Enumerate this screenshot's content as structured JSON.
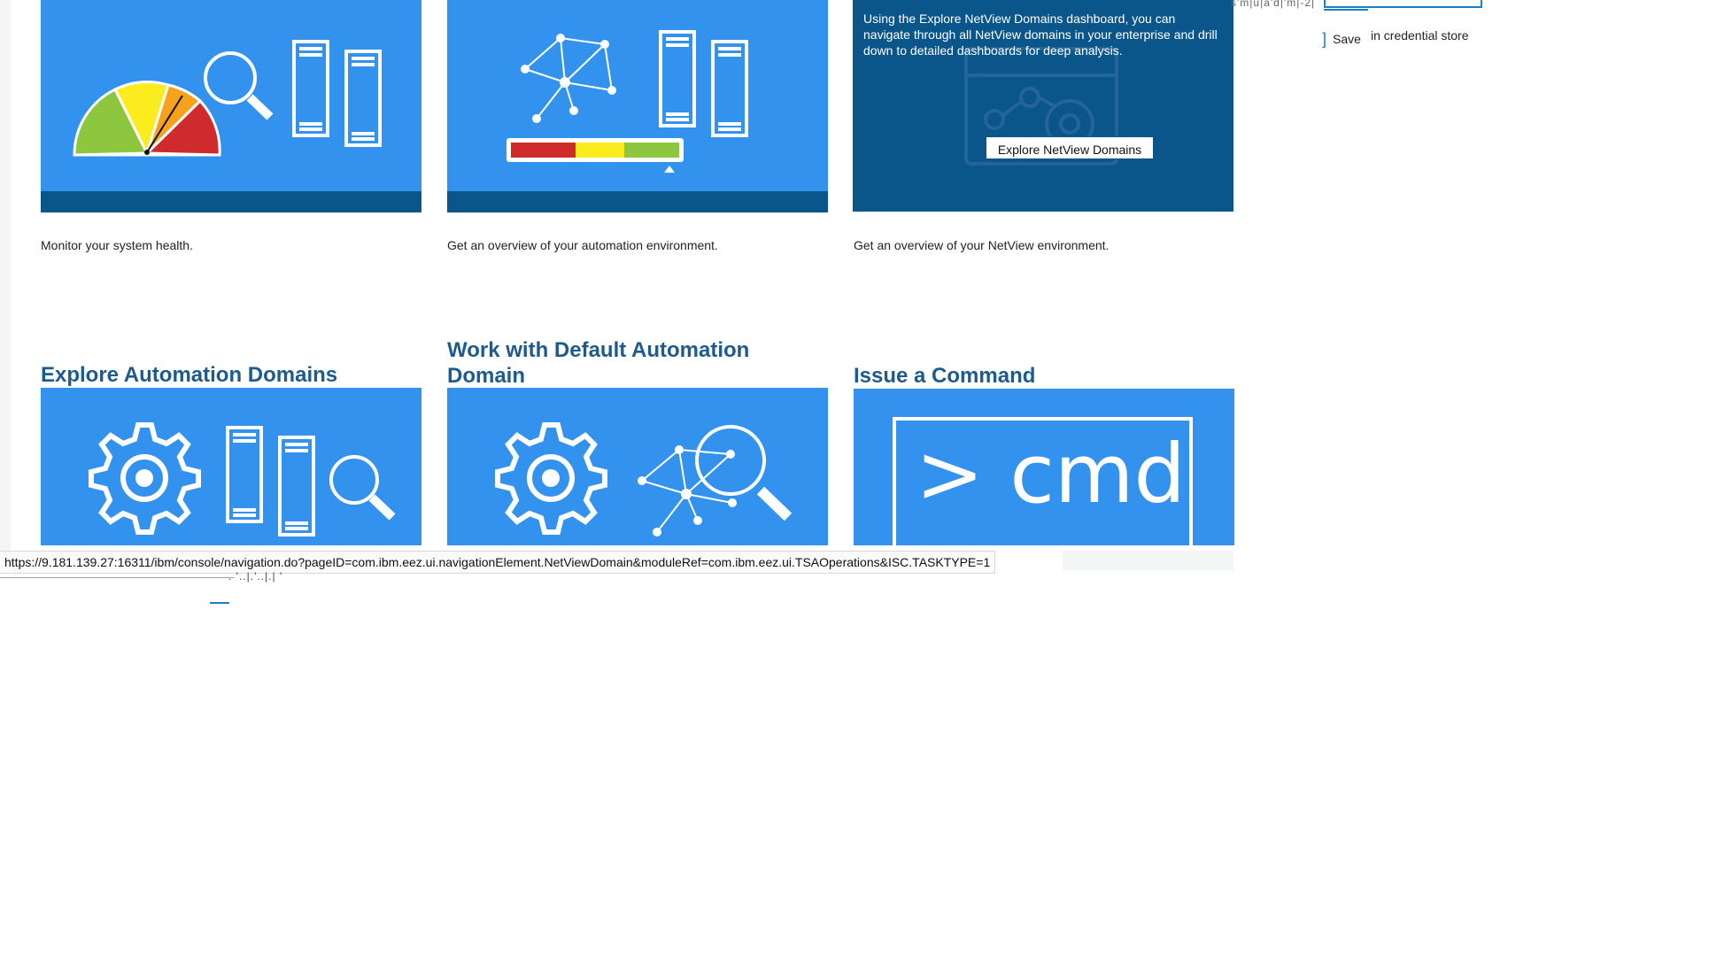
{
  "tiles_top": [
    {
      "description": "Monitor your system health."
    },
    {
      "description": "Get an overview of your automation environment."
    },
    {
      "description": "Get an overview of your NetView environment."
    }
  ],
  "netview_overlay": {
    "text": "Using the Explore NetView Domains dashboard, you can navigate through all NetView domains in your enterprise and drill down to detailed dashboards for deep analysis.",
    "button_label": "Explore NetView Domains"
  },
  "tiles_bottom": [
    {
      "title": "Explore Automation Domains"
    },
    {
      "title": "Work with Default Automation Domain"
    },
    {
      "title": "Issue a Command",
      "cmd_text": "> cmd"
    }
  ],
  "credentials": {
    "scribble": "s'm|u|a'd|'m|-2|",
    "save_label": "Save",
    "store_text": "in credential store"
  },
  "status_bar": {
    "url": "https://9.181.139.27:16311/ibm/console/navigation.do?pageID=com.ibm.eez.ui.navigationElement.NetViewDomain&moduleRef=com.ibm.eez.ui.TSAOperations&ISC.TASKTYPE=1"
  },
  "scribble_bottom": ". '..|.'..|.|  '",
  "colors": {
    "tile_blue": "#3392ee",
    "tile_dark": "#0a5589",
    "heading": "#1d5b8e",
    "gauge_green": "#8dc63f",
    "gauge_yellow": "#fbed1d",
    "gauge_orange": "#f7a21b",
    "gauge_red": "#cf2a2c"
  }
}
